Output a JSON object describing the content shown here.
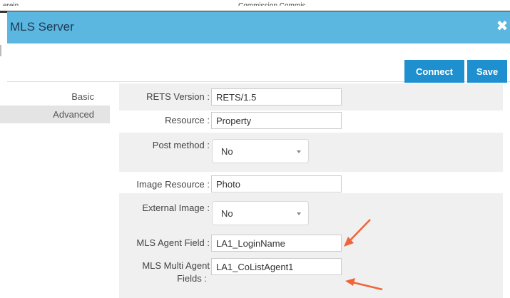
{
  "background": {
    "left_text": "erein",
    "center_text": "Commission Commis"
  },
  "modal": {
    "title": "MLS Server",
    "close_glyph": "✖",
    "buttons": {
      "connect": "Connect",
      "save": "Save"
    }
  },
  "sidebar": {
    "items": [
      {
        "label": "Basic",
        "active": false
      },
      {
        "label": "Advanced",
        "active": true
      }
    ]
  },
  "form": {
    "rets_version": {
      "label": "RETS Version :",
      "value": "RETS/1.5"
    },
    "resource": {
      "label": "Resource :",
      "value": "Property"
    },
    "post_method": {
      "label": "Post method :",
      "value": "No"
    },
    "image_resource": {
      "label": "Image Resource :",
      "value": "Photo"
    },
    "external_image": {
      "label": "External Image :",
      "value": "No"
    },
    "mls_agent_field": {
      "label": "MLS Agent Field :",
      "value": "LA1_LoginName"
    },
    "mls_multi_agent_fields": {
      "label_line1": "MLS Multi Agent",
      "label_line2": "Fields :",
      "value": "LA1_CoListAgent1"
    }
  },
  "colors": {
    "titlebar": "#5bb6e0",
    "primary_button": "#1e90d0",
    "annotation_arrow": "#f0643a"
  }
}
